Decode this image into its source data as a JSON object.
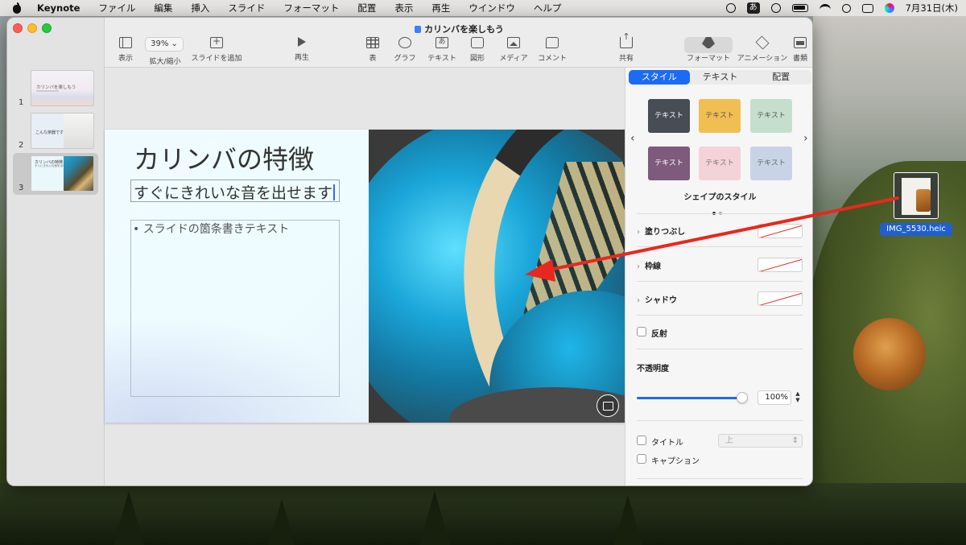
{
  "menubar": {
    "app": "Keynote",
    "items": [
      "ファイル",
      "編集",
      "挿入",
      "スライド",
      "フォーマット",
      "配置",
      "表示",
      "再生",
      "ウインドウ",
      "ヘルプ"
    ],
    "ime": "あ",
    "clock": "7月31日(木)"
  },
  "window": {
    "title": "カリンバを楽しもう"
  },
  "toolbar": {
    "zoom_value": "39%",
    "view": "表示",
    "zoom": "拡大/縮小",
    "add_slide": "スライドを追加",
    "play": "再生",
    "table": "表",
    "chart": "グラフ",
    "text": "テキスト",
    "shape": "図形",
    "media": "メディア",
    "comment": "コメント",
    "share": "共有",
    "format": "フォーマット",
    "animate": "アニメーション",
    "document": "書類"
  },
  "slides": [
    {
      "number": "1",
      "thumb_title": "カリンバを楽しもう"
    },
    {
      "number": "2",
      "thumb_title": "こんな楽器です"
    },
    {
      "number": "3",
      "thumb_title": "カリンバの特徴",
      "thumb_sub": "すぐにきれいな音を出せます"
    }
  ],
  "slide": {
    "title": "カリンバの特徴",
    "subtitle": "すぐにきれいな音を出せます",
    "bullet": "スライドの箇条書きテキスト"
  },
  "inspector": {
    "tabs": [
      "スタイル",
      "テキスト",
      "配置"
    ],
    "active_tab": "スタイル",
    "swatches": [
      {
        "label": "テキスト",
        "bg": "#474c55",
        "fg": "#ffffff"
      },
      {
        "label": "テキスト",
        "bg": "#f1be52",
        "fg": "#555555"
      },
      {
        "label": "テキスト",
        "bg": "#c6dfcc",
        "fg": "#555555"
      },
      {
        "label": "テキスト",
        "bg": "#7e5a7c",
        "fg": "#ffffff"
      },
      {
        "label": "テキスト",
        "bg": "#f3d3d8",
        "fg": "#777777"
      },
      {
        "label": "テキスト",
        "bg": "#c8d4e6",
        "fg": "#666666"
      }
    ],
    "shape_styles_label": "シェイプのスタイル",
    "fill": "塗りつぶし",
    "border": "枠線",
    "shadow": "シャドウ",
    "reflection": "反射",
    "opacity_label": "不透明度",
    "opacity_value": "100%",
    "opacity": 1.0,
    "title_label": "タイトル",
    "title_position": "上",
    "caption_label": "キャプション"
  },
  "desktop_file": {
    "name": "IMG_5530.heic"
  },
  "colors": {
    "accent": "#1b6bf4",
    "arrow": "#e8281e"
  }
}
